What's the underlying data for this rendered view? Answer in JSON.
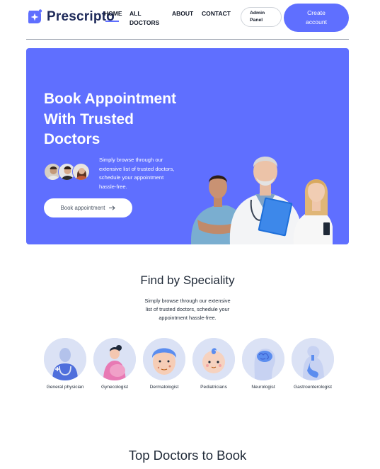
{
  "brand": {
    "name": "Prescripto"
  },
  "nav": {
    "home": "HOME",
    "all_doctors": [
      "ALL",
      "DOCTORS"
    ],
    "about": "ABOUT",
    "contact": "CONTACT",
    "admin_panel": [
      "Admin",
      "Panel"
    ],
    "create_account": [
      "Create",
      "account"
    ]
  },
  "hero": {
    "title": [
      "Book Appointment",
      "With Trusted",
      "Doctors"
    ],
    "subtitle": [
      "Simply browse through our",
      "extensive list of trusted doctors,",
      "schedule your appointment",
      "hassle-free."
    ],
    "button": "Book appointment",
    "button_icon": "arrow-right-icon"
  },
  "speciality": {
    "title": "Find by Speciality",
    "description": [
      "Simply browse through our extensive",
      "list of trusted doctors, schedule your",
      "appointment hassle-free."
    ],
    "items": [
      {
        "label": "General physician",
        "icon": "general-physician-icon"
      },
      {
        "label": "Gynecologist",
        "icon": "gynecologist-icon"
      },
      {
        "label": "Dermatologist",
        "icon": "dermatologist-icon"
      },
      {
        "label": "Pediatricians",
        "icon": "pediatrician-icon"
      },
      {
        "label": "Neurologist",
        "icon": "neurologist-icon"
      },
      {
        "label": "Gastroenterologist",
        "icon": "gastroenterologist-icon"
      }
    ]
  },
  "top_doctors": {
    "title": "Top Doctors to Book"
  },
  "colors": {
    "primary": "#5f6fff",
    "brand_text": "#1e2a5a",
    "speciality_bg": "#dbe2f5"
  }
}
